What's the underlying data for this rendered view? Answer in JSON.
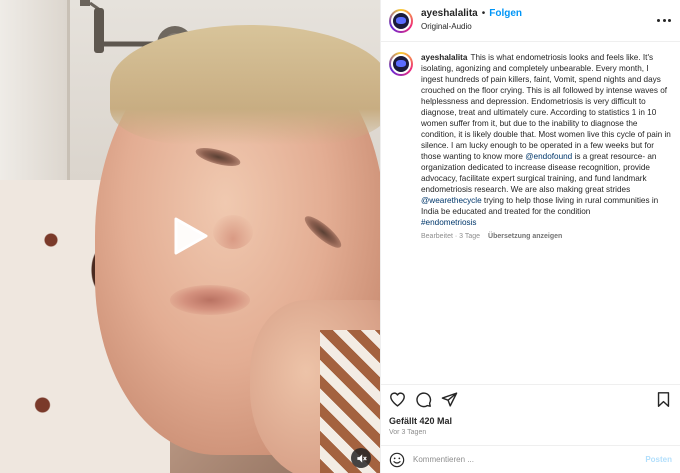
{
  "post": {
    "username": "ayeshalalita",
    "separator": "•",
    "follow_label": "Folgen",
    "audio_label": "Original-Audio"
  },
  "caption": {
    "username": "ayeshalalita",
    "text_1": "This is what endometriosis looks and feels like. It's isolating, agonizing and completely unbearable. Every month, I ingest hundreds of pain killers, faint, Vomit, spend nights and days crouched on the floor crying. This is all followed by intense waves of helplessness and depression. Endometriosis is very difficult to diagnose, treat and ultimately cure. According to statistics 1 in 10 women suffer from it, but due to the inability to diagnose the condition, it is likely double that. Most women live this cycle of pain in silence. I am lucky enough to be operated in a few weeks but for those wanting to know more ",
    "mention_1": "@endofound",
    "text_2": " is a great resource- an organization dedicated to increase disease recognition, provide advocacy, facilitate expert surgical training, and fund landmark endometriosis research. We are also making great strides",
    "mention_2": "@wearethecycle",
    "text_3": " trying to help those living in rural communities in India be educated and treated for the condition",
    "hashtag": "#endometriosis",
    "edited_label": "Bearbeitet · 3 Tage",
    "translate_label": "Übersetzung anzeigen"
  },
  "stats": {
    "likes": "Gefällt 420 Mal",
    "time_ago": "Vor 3 Tagen"
  },
  "comment": {
    "placeholder": "Kommentieren ...",
    "post_label": "Posten"
  },
  "icons": {
    "play": "play-icon",
    "mute": "muted-speaker-icon",
    "like": "heart-icon",
    "comment": "comment-bubble-icon",
    "share": "paper-plane-icon",
    "save": "bookmark-icon",
    "more": "more-dots-icon",
    "emoji": "smiley-icon"
  },
  "colors": {
    "follow": "#0095f6",
    "link": "#00376b",
    "post_disabled": "#b2dffc",
    "muted_text": "#8e8e8e"
  }
}
